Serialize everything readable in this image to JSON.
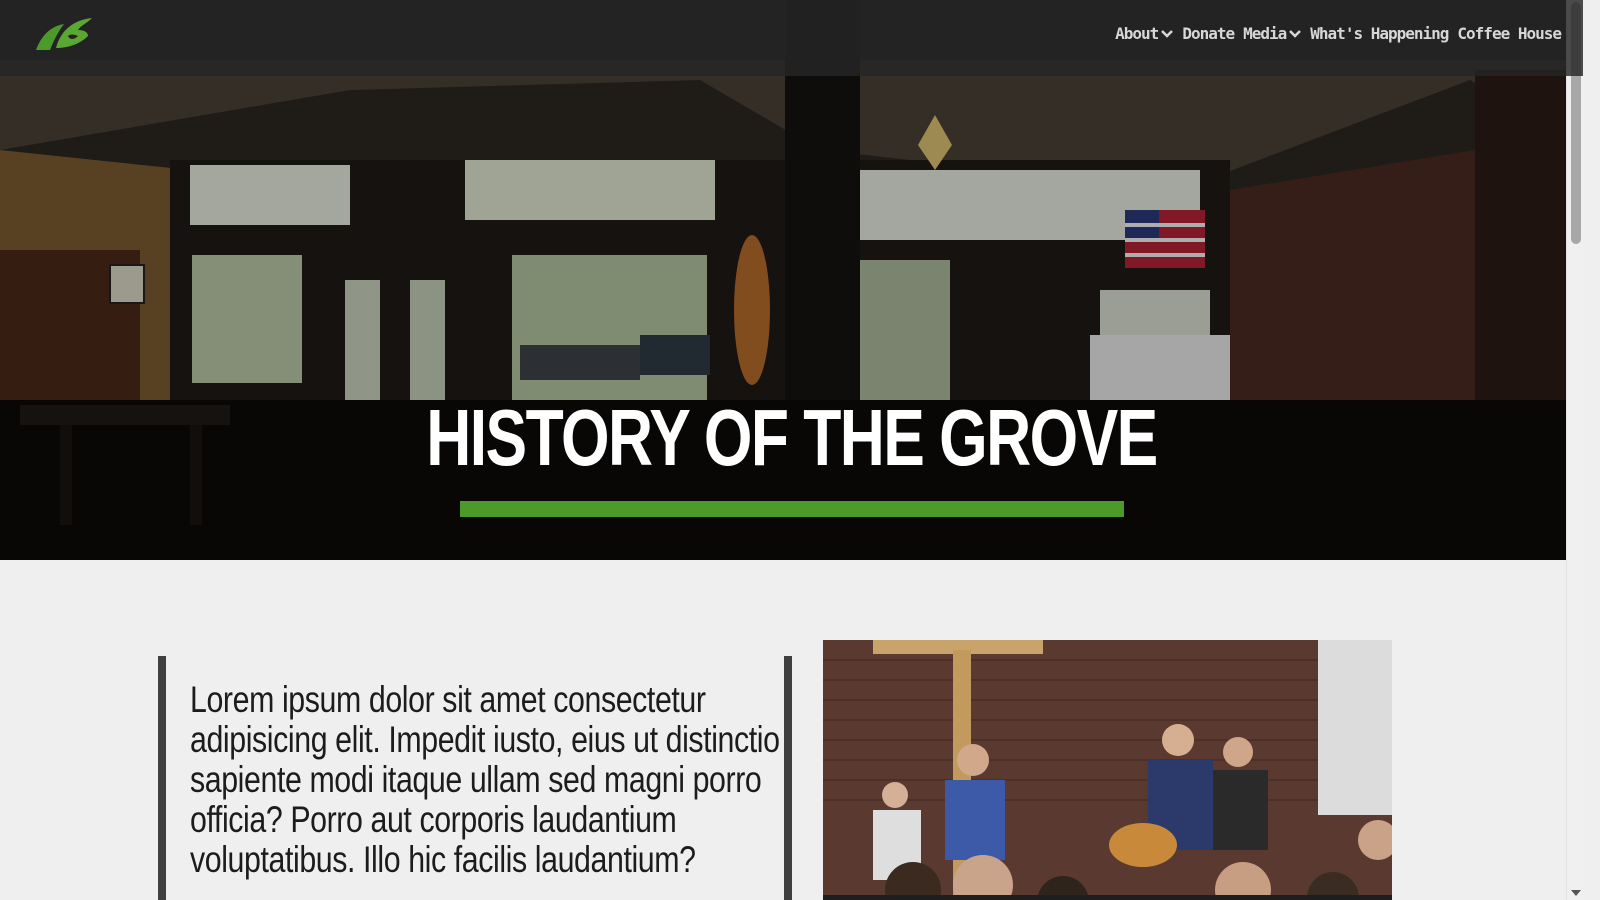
{
  "navbar": {
    "logo_icon": "grove-leaf-logo-icon",
    "items": [
      {
        "label": "About",
        "dropdown": true
      },
      {
        "label": "Donate",
        "dropdown": false
      },
      {
        "label": "Media",
        "dropdown": true
      },
      {
        "label": "What's Happening",
        "dropdown": false
      },
      {
        "label": "Coffee House",
        "dropdown": false
      }
    ]
  },
  "hero": {
    "title": "HISTORY OF THE GROVE",
    "accent_color": "#4c9a2a"
  },
  "content": {
    "quote": "Lorem ipsum dolor sit amet consectetur adipisicing elit. Impedit iusto, eius ut distinctio sapiente modi itaque ullam sed magni porro officia? Porro aut corporis laudantium voluptatibus. Illo hic facilis laudantium?"
  },
  "colors": {
    "navbar_bg": "#262626",
    "nav_text": "#d7d7d7",
    "page_bg": "#efefef",
    "quote_border": "#3f3f3f"
  }
}
